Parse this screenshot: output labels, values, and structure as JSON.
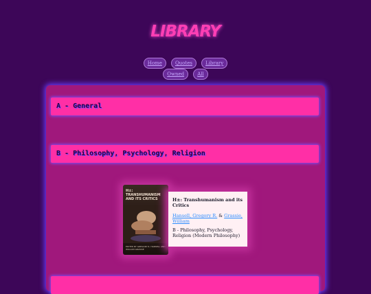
{
  "header": {
    "title": "LIBRARY"
  },
  "nav": {
    "row1": [
      "Home",
      "Quotes",
      "Library"
    ],
    "row2": [
      "Owned",
      "All"
    ]
  },
  "sections": [
    {
      "label": "A - General"
    },
    {
      "label": "B - Philosophy, Psychology, Religion"
    }
  ],
  "book": {
    "cover_title": "H±: TRANSHUMANISM AND ITS CRITICS",
    "cover_authors": "EDITED BY GREGORY R. HANSELL AND WILLIAM GRASSIE",
    "title": "H±: Transhumanism and its Critics",
    "author1": "Hansell, Gregory R.",
    "sep": " & ",
    "author2": "Grassie, William",
    "category": "B - Philosophy, Psychology, Religion (Modern Philosophy)"
  },
  "colors": {
    "background": "#3d0658",
    "panel": "#a0187c",
    "header": "#ff2fa6",
    "title": "#ff3fb4"
  }
}
